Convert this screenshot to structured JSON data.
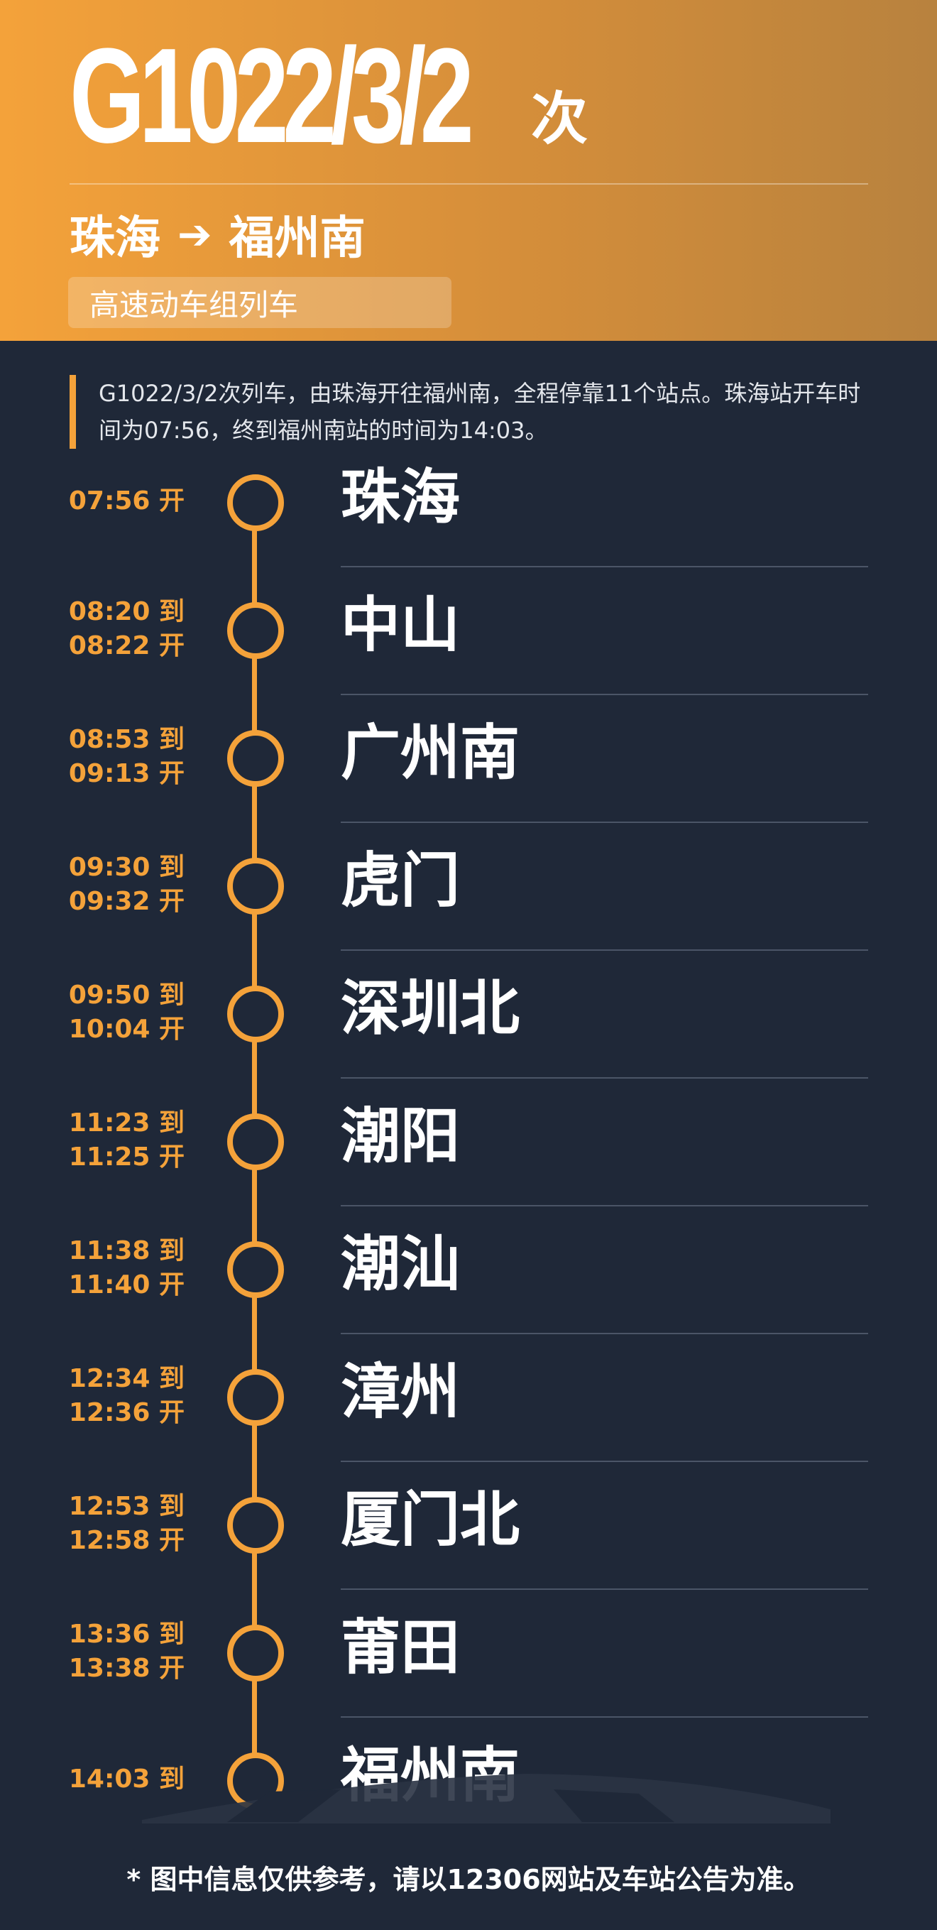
{
  "header": {
    "train_number": "G1022/3/2",
    "train_suffix": "次",
    "from": "珠海",
    "arrow": "➔",
    "to": "福州南",
    "train_type": "高速动车组列车"
  },
  "summary": "G1022/3/2次列车，由珠海开往福州南，全程停靠11个站点。珠海站开车时间为07:56，终到福州南站的时间为14:03。",
  "stops": [
    {
      "name": "珠海",
      "times": [
        "07:56 开"
      ]
    },
    {
      "name": "中山",
      "times": [
        "08:20 到",
        "08:22 开"
      ]
    },
    {
      "name": "广州南",
      "times": [
        "08:53 到",
        "09:13 开"
      ]
    },
    {
      "name": "虎门",
      "times": [
        "09:30 到",
        "09:32 开"
      ]
    },
    {
      "name": "深圳北",
      "times": [
        "09:50 到",
        "10:04 开"
      ]
    },
    {
      "name": "潮阳",
      "times": [
        "11:23 到",
        "11:25 开"
      ]
    },
    {
      "name": "潮汕",
      "times": [
        "11:38 到",
        "11:40 开"
      ]
    },
    {
      "name": "漳州",
      "times": [
        "12:34 到",
        "12:36 开"
      ]
    },
    {
      "name": "厦门北",
      "times": [
        "12:53 到",
        "12:58 开"
      ]
    },
    {
      "name": "莆田",
      "times": [
        "13:36 到",
        "13:38 开"
      ]
    },
    {
      "name": "福州南",
      "times": [
        "14:03 到"
      ]
    }
  ],
  "footer": "* 图中信息仅供参考，请以12306网站及车站公告为准。",
  "colors": {
    "accent": "#f4a23a",
    "background": "#1f2838",
    "separator": "#4b5567"
  }
}
